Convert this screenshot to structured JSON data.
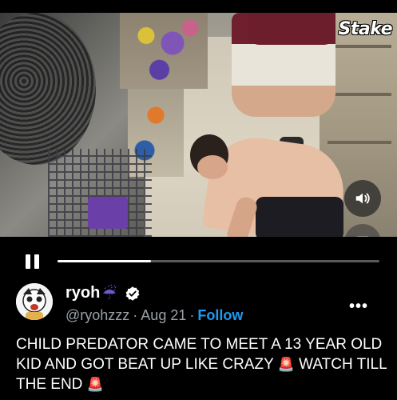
{
  "video": {
    "watermark": "Stake",
    "progress_fraction": 0.29
  },
  "tweet": {
    "display_name": "ryoh",
    "name_emoji": "☔",
    "handle": "@ryohzzz",
    "date": "Aug 21",
    "separator": "·",
    "follow_label": "Follow",
    "more_label": "•••",
    "text_part1": "CHILD PREDATOR CAME TO MEET A 13 YEAR OLD KID AND GOT BEAT UP LIKE CRAZY ",
    "emoji_siren": "🚨",
    "text_part2": " WATCH TILL THE END ",
    "emoji_siren_end": "🚨"
  },
  "colors": {
    "accent_blue": "#1d9bf0",
    "muted_gray": "#9aa0a6",
    "background": "#000000"
  },
  "icons": {
    "volume": "speaker-icon",
    "captions": "closed-captions-icon",
    "pause": "pause-icon",
    "verified": "verified-badge-icon",
    "more": "more-options-icon"
  }
}
